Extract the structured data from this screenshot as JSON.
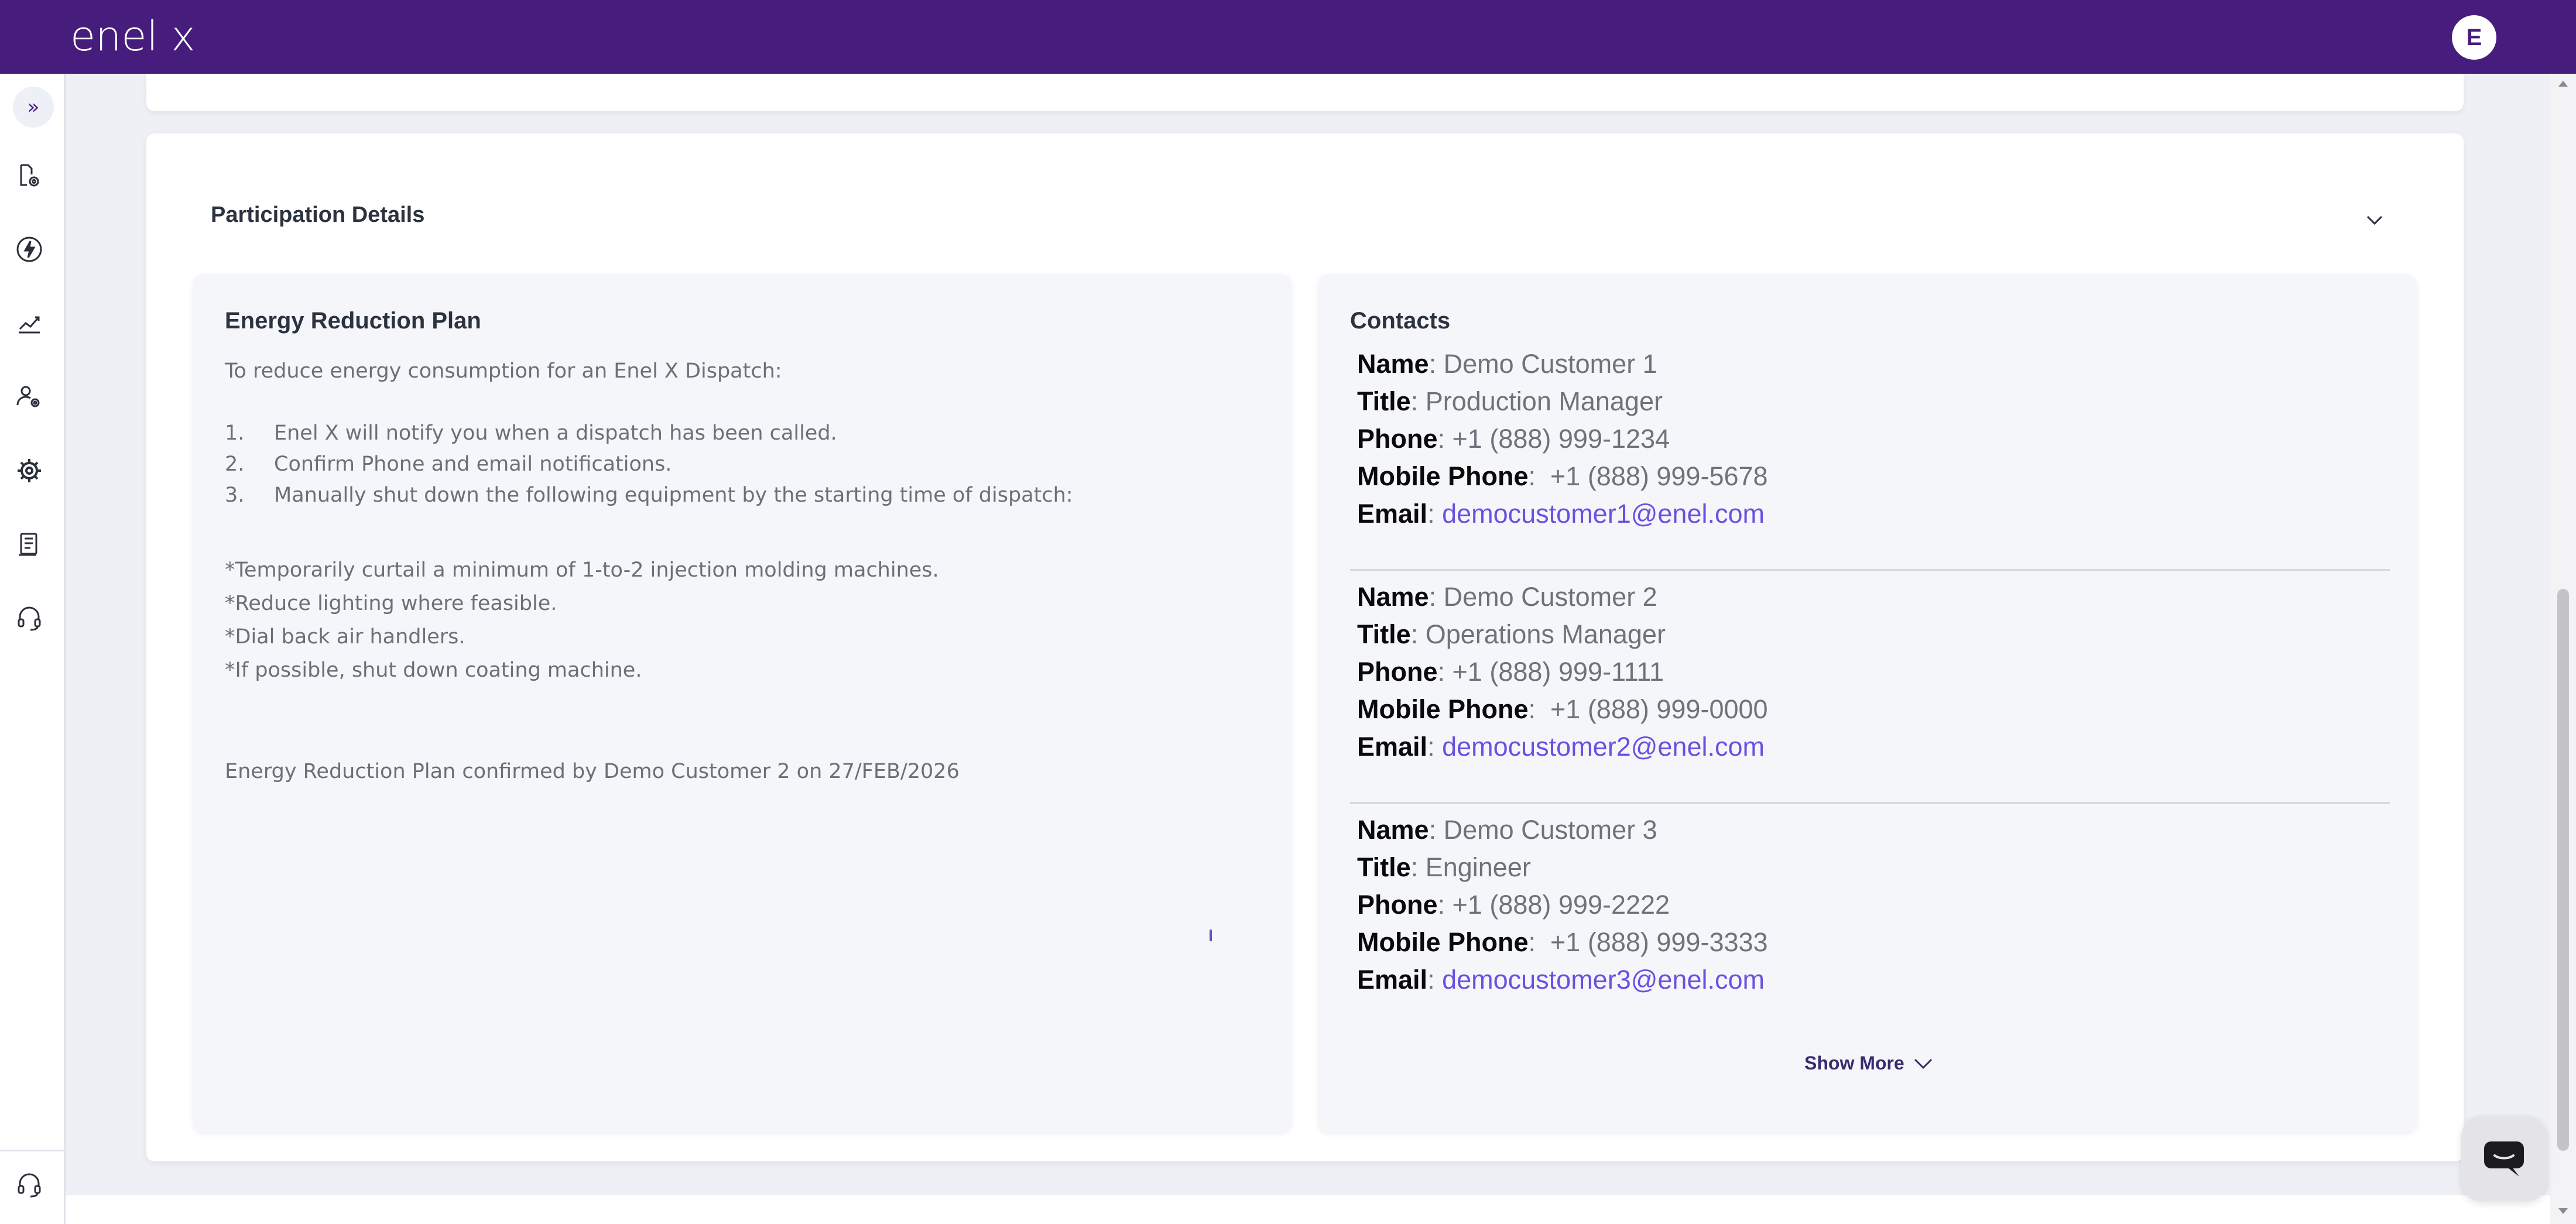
{
  "header": {
    "logo_text": "enel x",
    "avatar_initial": "E",
    "brand_color": "#461d7c"
  },
  "sidebar": {
    "expand_glyph": "»",
    "icons": [
      "site-settings-icon",
      "lightning-icon",
      "chart-trend-icon",
      "user-settings-icon",
      "gear-icon",
      "document-icon",
      "headset-icon"
    ],
    "bottom_icon": "headset-icon"
  },
  "section": {
    "title": "Participation Details"
  },
  "plan": {
    "title": "Energy Reduction Plan",
    "intro": "To reduce energy consumption for an Enel X Dispatch:",
    "steps": [
      {
        "num": "1.",
        "text": "Enel X will notify you when a dispatch has been called."
      },
      {
        "num": "2.",
        "text": "Confirm Phone and email notifications."
      },
      {
        "num": "3.",
        "text": "Manually shut down the following equipment by the starting time of dispatch:"
      }
    ],
    "notes": [
      "*Temporarily curtail a minimum of 1-to-2 injection molding machines.",
      "*Reduce lighting where feasible.",
      "*Dial back air handlers.",
      "*If possible, shut down coating machine."
    ],
    "confirmation": "Energy Reduction Plan confirmed by Demo Customer 2 on 27/FEB/2026"
  },
  "contacts": {
    "title": "Contacts",
    "labels": {
      "name": "Name",
      "title": "Title",
      "phone": "Phone",
      "mobile": "Mobile Phone",
      "email": "Email"
    },
    "items": [
      {
        "name": "Demo Customer 1",
        "title": "Production Manager",
        "phone": "+1 (888) 999-1234",
        "mobile": "+1 (888) 999-5678",
        "email": "democustomer1@enel.com"
      },
      {
        "name": "Demo Customer 2",
        "title": "Operations Manager",
        "phone": "+1 (888) 999-1111",
        "mobile": "+1 (888) 999-0000",
        "email": "democustomer2@enel.com"
      },
      {
        "name": "Demo Customer 3",
        "title": "Engineer",
        "phone": "+1 (888) 999-2222",
        "mobile": "+1 (888) 999-3333",
        "email": "democustomer3@enel.com"
      }
    ],
    "show_more_label": "Show More"
  }
}
